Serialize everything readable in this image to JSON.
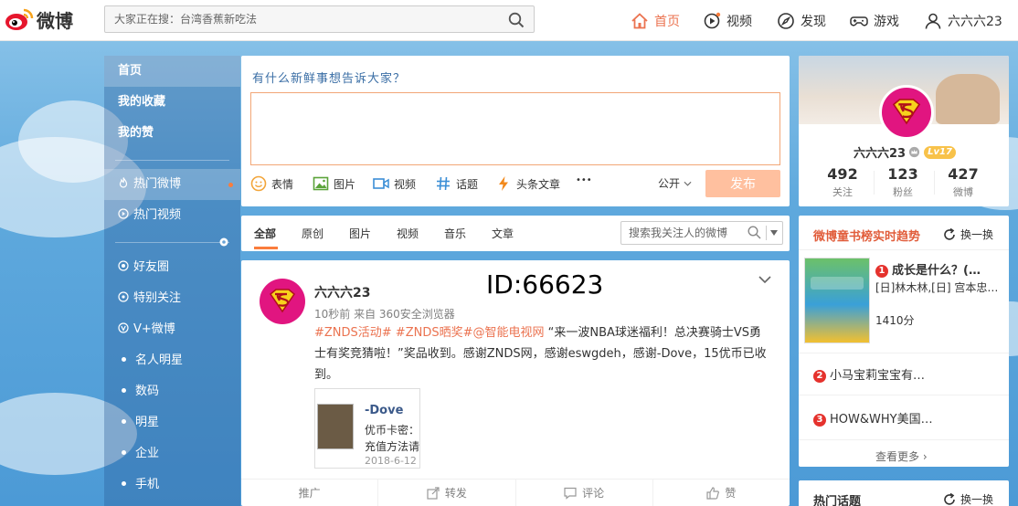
{
  "brand": {
    "logo_text": "微博"
  },
  "search": {
    "placeholder": "大家正在搜：台湾香蕉新吃法"
  },
  "nav": {
    "home": "首页",
    "video": "视频",
    "discover": "发现",
    "games": "游戏",
    "user": "六六六23"
  },
  "sidebar": {
    "items": [
      {
        "label": "首页"
      },
      {
        "label": "我的收藏"
      },
      {
        "label": "我的赞"
      },
      {
        "label": "热门微博"
      },
      {
        "label": "热门视频"
      },
      {
        "label": "好友圈"
      },
      {
        "label": "特别关注"
      },
      {
        "label": "V+微博"
      },
      {
        "label": "名人明星"
      },
      {
        "label": "数码"
      },
      {
        "label": "明星"
      },
      {
        "label": "企业"
      },
      {
        "label": "手机"
      }
    ]
  },
  "compose": {
    "prompt": "有什么新鲜事想告诉大家？",
    "tools": [
      "表情",
      "图片",
      "视频",
      "话题",
      "头条文章",
      "•••"
    ],
    "visibility": "公开",
    "publish": "发布"
  },
  "feed_tabs": {
    "tabs": [
      "全部",
      "原创",
      "图片",
      "视频",
      "音乐",
      "文章"
    ],
    "search_placeholder": "搜索我关注人的微博"
  },
  "post": {
    "user": "六六六23",
    "id_label": "ID:66623",
    "meta": "10秒前 来自 360安全浏览器",
    "hashtags": "#ZNDS活动# #ZNDS晒奖#@智能电视网",
    "text": " “来一波NBA球迷福利！总决赛骑士VS勇士有奖竞猜啦！”奖品收到。感谢ZNDS网，感谢eswgdeh，感谢-Dove，15优币已收到。",
    "thumb": {
      "name": "-Dove",
      "line1": "优币卡密：4",
      "line2": "充值方法请",
      "date": "2018-6-12"
    },
    "actions": [
      "推广",
      "转发",
      "评论",
      "赞"
    ]
  },
  "profile": {
    "name": "六六六23",
    "level": "Lv17",
    "stats": [
      {
        "num": "492",
        "label": "关注"
      },
      {
        "num": "123",
        "label": "粉丝"
      },
      {
        "num": "427",
        "label": "微博"
      }
    ]
  },
  "trend": {
    "title": "微博童书榜实时趋势",
    "refresh": "换一换",
    "items": [
      {
        "rank": "1",
        "title": "成长是什么？(…",
        "author": "[日]林木林,[日] 宫本忠…",
        "score": "1410分"
      },
      {
        "rank": "2",
        "title": "小马宝莉宝宝有…"
      },
      {
        "rank": "3",
        "title": "HOW&WHY美国…"
      }
    ],
    "more": "查看更多 ›"
  },
  "hot": {
    "title": "热门话题",
    "refresh": "换一换"
  },
  "colors": {
    "accent": "#eb7350",
    "publish_disabled": "#ffc09f",
    "link": "#eb7350",
    "brand_red": "#e6162d"
  }
}
